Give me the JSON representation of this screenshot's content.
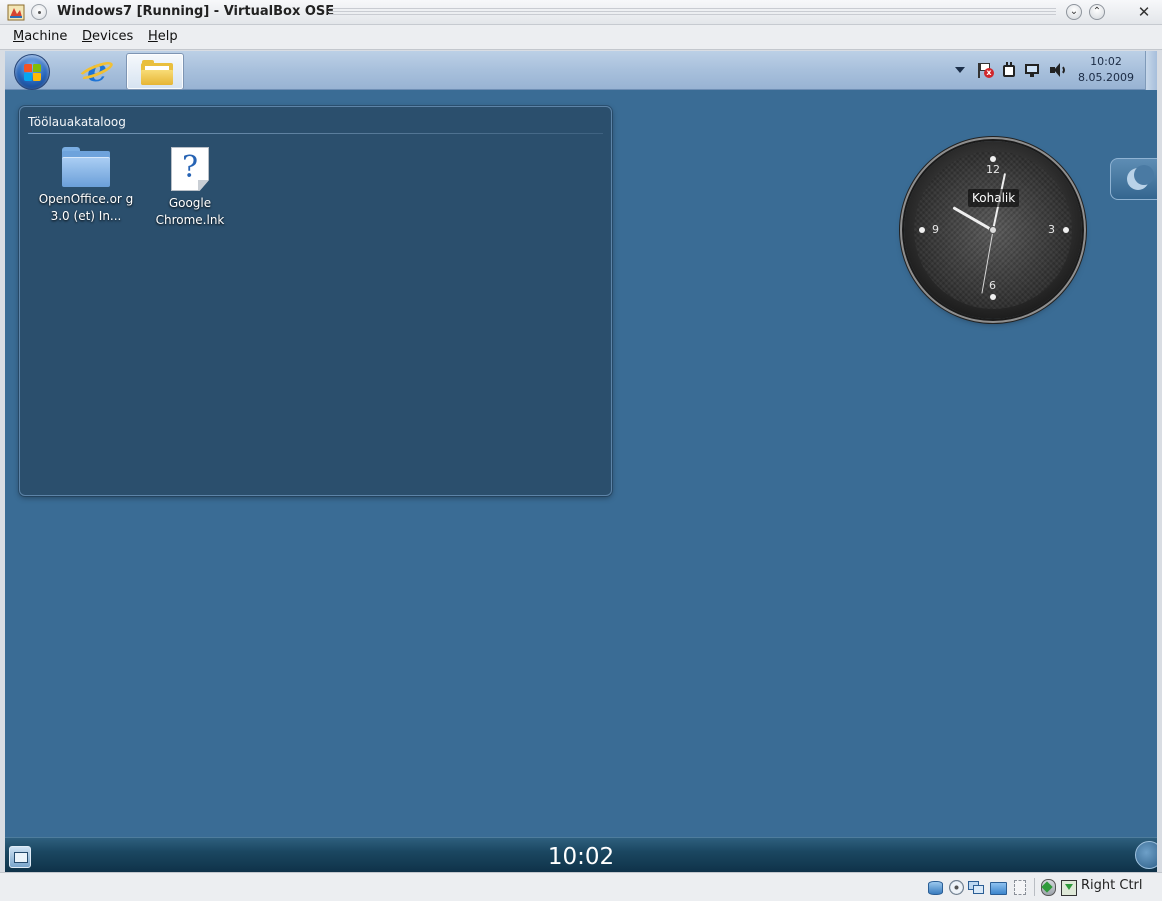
{
  "window": {
    "title": "Windows7 [Running] - VirtualBox OSE"
  },
  "menubar": {
    "items": [
      {
        "label": "Machine",
        "mnemonic": "M"
      },
      {
        "label": "Devices",
        "mnemonic": "D"
      },
      {
        "label": "Help",
        "mnemonic": "H"
      }
    ]
  },
  "guest": {
    "taskbar": {
      "pinned": [
        "start-button",
        "internet-explorer",
        "windows-explorer"
      ],
      "tray": {
        "time": "10:02",
        "date": "8.05.2009"
      }
    },
    "folder_panel": {
      "title": "Töölauakataloog",
      "items": [
        {
          "label": "OpenOffice.or g 3.0 (et) In...",
          "icon": "folder-icon"
        },
        {
          "label": "Google Chrome.lnk",
          "icon": "unknown-file-icon"
        }
      ]
    },
    "clock_gadget": {
      "label": "Kohalik",
      "numerals": {
        "n12": "12",
        "n3": "3",
        "n6": "6",
        "n9": "9"
      }
    },
    "bottom_bar": {
      "time": "10:02"
    }
  },
  "statusbar": {
    "host_key": "Right Ctrl"
  }
}
